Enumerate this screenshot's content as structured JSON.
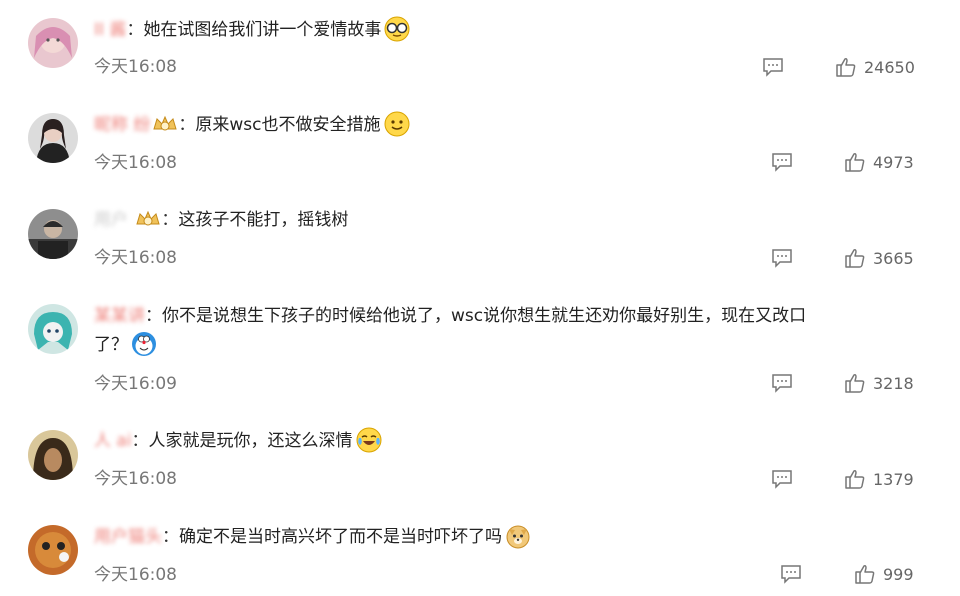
{
  "comments": [
    {
      "user": "II 酱",
      "text": "她在试图给我们讲一个爱情故事",
      "time": "今天16:08",
      "likes": "24650"
    },
    {
      "user": "昵称 纷",
      "text": "原来wsc也不做安全措施",
      "time": "今天16:08",
      "likes": "4973"
    },
    {
      "user": "用户 ",
      "text": "这孩子不能打，摇钱树",
      "time": "今天16:08",
      "likes": "3665"
    },
    {
      "user": "某某讲",
      "text": "你不是说想生下孩子的时候给他说了，wsc说你想生就生还劝你最好别生，现在又改口",
      "text2": "了？",
      "time": "今天16:09",
      "likes": "3218"
    },
    {
      "user": "人 ai",
      "text": "人家就是玩你，还这么深情",
      "time": "今天16:08",
      "likes": "1379"
    },
    {
      "user": "用户猫头",
      "text": "确定不是当时高兴坏了而不是当时吓坏了吗",
      "time": "今天16:08",
      "likes": "999"
    }
  ],
  "colon": "："
}
